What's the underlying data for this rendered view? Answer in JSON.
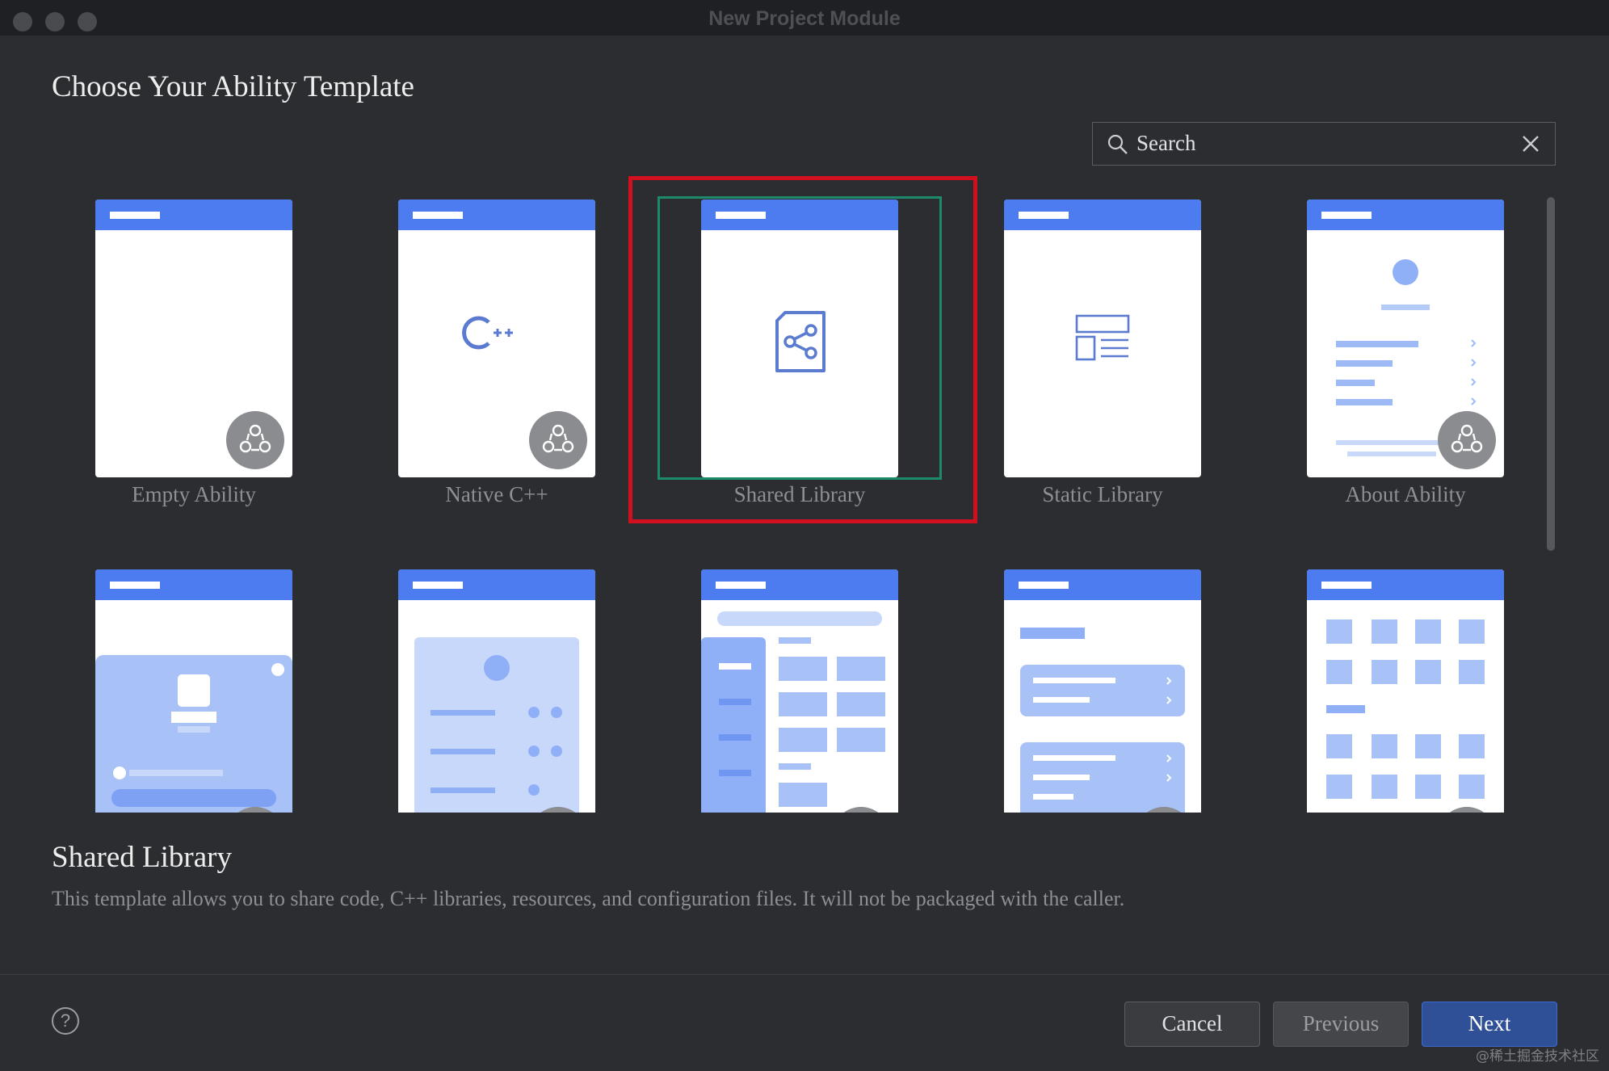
{
  "window": {
    "title": "New Project Module",
    "traffic_lights": [
      "close-button",
      "minimize-button",
      "zoom-button"
    ]
  },
  "heading": "Choose Your Ability Template",
  "search": {
    "placeholder": "Search",
    "icon": "search-icon",
    "clear_icon": "close-icon"
  },
  "templates": [
    {
      "label": "Empty Ability",
      "art": "blank",
      "badge": true
    },
    {
      "label": "Native C++",
      "art": "cpp",
      "badge": true
    },
    {
      "label": "Shared Library",
      "art": "shared-library",
      "badge": false,
      "selected": true
    },
    {
      "label": "Static Library",
      "art": "static-library",
      "badge": false
    },
    {
      "label": "About Ability",
      "art": "about",
      "badge": true
    }
  ],
  "templates_row2_arts": [
    "login",
    "detail-list",
    "sidebar-grid",
    "card-list",
    "icon-grid"
  ],
  "description": {
    "title": "Shared Library",
    "text": "This template allows you to share code, C++ libraries, resources, and configuration files. It will not be packaged with the caller."
  },
  "footer": {
    "help_label": "?",
    "cancel_label": "Cancel",
    "previous_label": "Previous",
    "next_label": "Next"
  },
  "watermark": "@稀土掘金技术社区",
  "colors": {
    "accent": "#4c7cf0",
    "selection_green": "#1e8a6c",
    "highlight_red": "#d10f1f",
    "background": "#2b2d30"
  }
}
